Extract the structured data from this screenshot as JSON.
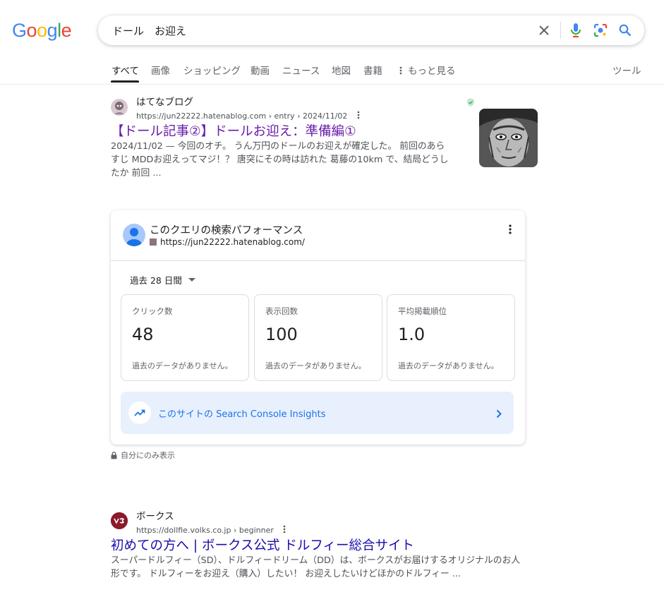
{
  "logo": {
    "text": "Google"
  },
  "search": {
    "query": "ドール　お迎え"
  },
  "tabs": [
    {
      "label": "すべて"
    },
    {
      "label": "画像"
    },
    {
      "label": "ショッピング"
    },
    {
      "label": "動画"
    },
    {
      "label": "ニュース"
    },
    {
      "label": "地図"
    },
    {
      "label": "書籍"
    },
    {
      "label": "もっと見る"
    }
  ],
  "tools_label": "ツール",
  "results": [
    {
      "site_name": "はてなブログ",
      "url": "https://jun22222.hatenablog.com › entry › 2024/11/02",
      "title": "【ドール記事②】ドールお迎え：準備編①",
      "snippet": "2024/11/02 — 今回のオチ。 うん万円のドールのお迎えが確定した。 前回のあらすじ MDDお迎えってマジ！？ 唐突にその時は訪れた 葛藤の10km で、結局どうしたか 前回 ..."
    },
    {
      "site_name": "ボークス",
      "url": "https://dollfie.volks.co.jp › beginner",
      "title": "初めての方へ | ボークス公式 ドルフィー総合サイト",
      "snippet": "スーパードルフィー（SD）、ドルフィードリーム（DD）は、ボークスがお届けするオリジナルのお人形です。 ドルフィーをお迎え（購入）したい！ お迎えしたいけどほかのドルフィー ..."
    }
  ],
  "perf_card": {
    "title": "このクエリの検索パフォーマンス",
    "site_url": "https://jun22222.hatenablog.com/",
    "period": "過去 28 日間",
    "metrics": [
      {
        "label": "クリック数",
        "value": "48",
        "note": "過去のデータがありません。"
      },
      {
        "label": "表示回数",
        "value": "100",
        "note": "過去のデータがありません。"
      },
      {
        "label": "平均掲載順位",
        "value": "1.0",
        "note": "過去のデータがありません。"
      }
    ],
    "insights_label": "このサイトの Search Console Insights"
  },
  "private_note": "自分にのみ表示",
  "colors": {
    "link_visited": "#681da8",
    "link": "#1a0dab",
    "insights_text": "#1a73e8"
  }
}
